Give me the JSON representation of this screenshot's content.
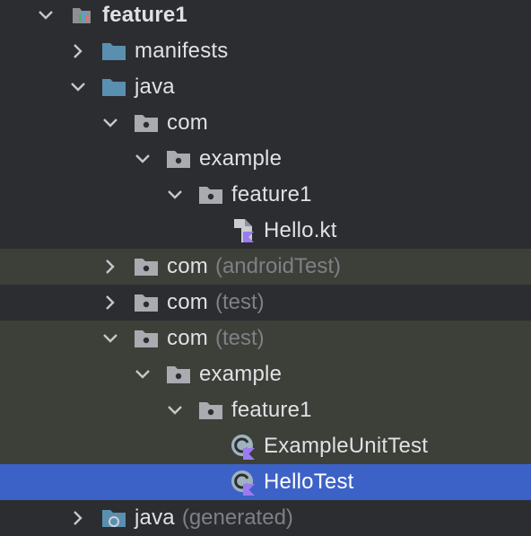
{
  "colors": {
    "background": "#2b2d30",
    "test_row_background": "#3c4038",
    "selection": "#3d62c7",
    "text": "#dfe1e5",
    "muted_text": "#7d8087",
    "folder_blue": "#5a8fb0",
    "package_gray": "#a9abb0",
    "kotlin_purple": "#9b7bf0"
  },
  "tree": {
    "nodes": [
      {
        "label": "feature1",
        "suffix": "",
        "icon": "module-icon",
        "chevron": "expanded",
        "depth": 0,
        "bg": "none"
      },
      {
        "label": "manifests",
        "suffix": "",
        "icon": "folder-icon",
        "chevron": "collapsed",
        "depth": 1,
        "bg": "none"
      },
      {
        "label": "java",
        "suffix": "",
        "icon": "folder-icon",
        "chevron": "expanded",
        "depth": 1,
        "bg": "none"
      },
      {
        "label": "com",
        "suffix": "",
        "icon": "package-icon",
        "chevron": "expanded",
        "depth": 2,
        "bg": "none"
      },
      {
        "label": "example",
        "suffix": "",
        "icon": "package-icon",
        "chevron": "expanded",
        "depth": 3,
        "bg": "none"
      },
      {
        "label": "feature1",
        "suffix": "",
        "icon": "package-icon",
        "chevron": "expanded",
        "depth": 4,
        "bg": "none"
      },
      {
        "label": "Hello.kt",
        "suffix": "",
        "icon": "kotlin-file-icon",
        "chevron": "none",
        "depth": 5,
        "bg": "none"
      },
      {
        "label": "com",
        "suffix": "(androidTest)",
        "icon": "package-icon",
        "chevron": "collapsed",
        "depth": 2,
        "bg": "test"
      },
      {
        "label": "com",
        "suffix": "(test)",
        "icon": "package-icon",
        "chevron": "collapsed",
        "depth": 2,
        "bg": "none"
      },
      {
        "label": "com",
        "suffix": "(test)",
        "icon": "package-icon",
        "chevron": "expanded",
        "depth": 2,
        "bg": "test"
      },
      {
        "label": "example",
        "suffix": "",
        "icon": "package-icon",
        "chevron": "expanded",
        "depth": 3,
        "bg": "test"
      },
      {
        "label": "feature1",
        "suffix": "",
        "icon": "package-icon",
        "chevron": "expanded",
        "depth": 4,
        "bg": "test"
      },
      {
        "label": "ExampleUnitTest",
        "suffix": "",
        "icon": "kotlin-class-icon",
        "chevron": "none",
        "depth": 5,
        "bg": "test"
      },
      {
        "label": "HelloTest",
        "suffix": "",
        "icon": "kotlin-class-icon",
        "chevron": "none",
        "depth": 5,
        "bg": "selected"
      },
      {
        "label": "java",
        "suffix": "(generated)",
        "icon": "generated-folder-icon",
        "chevron": "collapsed",
        "depth": 1,
        "bg": "none"
      }
    ]
  }
}
